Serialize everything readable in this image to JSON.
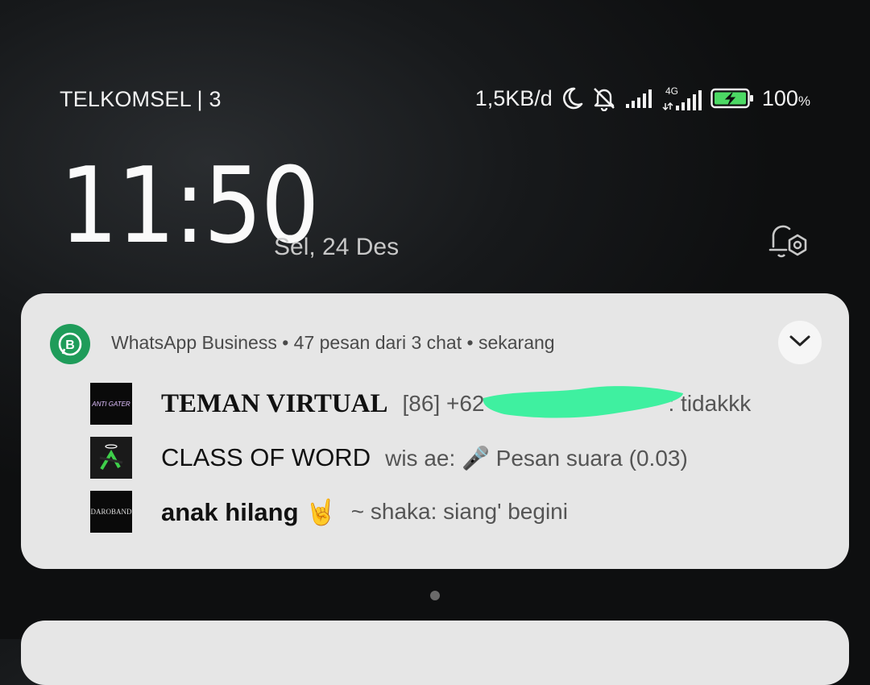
{
  "status_bar": {
    "carrier": "TELKOMSEL | 3",
    "net_speed": "1,5KB/d",
    "network_type": "4G",
    "battery_percent": "100",
    "battery_unit": "%",
    "icons": [
      "moon-icon",
      "bell-off-icon",
      "signal-icon",
      "signal-4g-icon",
      "battery-charging-icon"
    ]
  },
  "lockscreen": {
    "time": "11:50",
    "date": "Sel, 24 Des"
  },
  "notification": {
    "app_name": "WhatsApp Business",
    "summary": "47 pesan dari 3 chat",
    "when": "sekarang",
    "header_separator": " • ",
    "brand_color": "#1f9c5a",
    "chats": [
      {
        "name": "TEMAN VIRTUAL",
        "preview_left": "[86] +62",
        "preview_right": ": tidakkk",
        "avatar_text": "ANTI GATER"
      },
      {
        "name": "CLASS OF WORD",
        "preview": "wis ae: 🎤 Pesan suara (0.03)"
      },
      {
        "name": "anak hilang 🤘",
        "preview": "~ shaka: siang' begini",
        "avatar_text": "DAROBAND"
      }
    ]
  }
}
